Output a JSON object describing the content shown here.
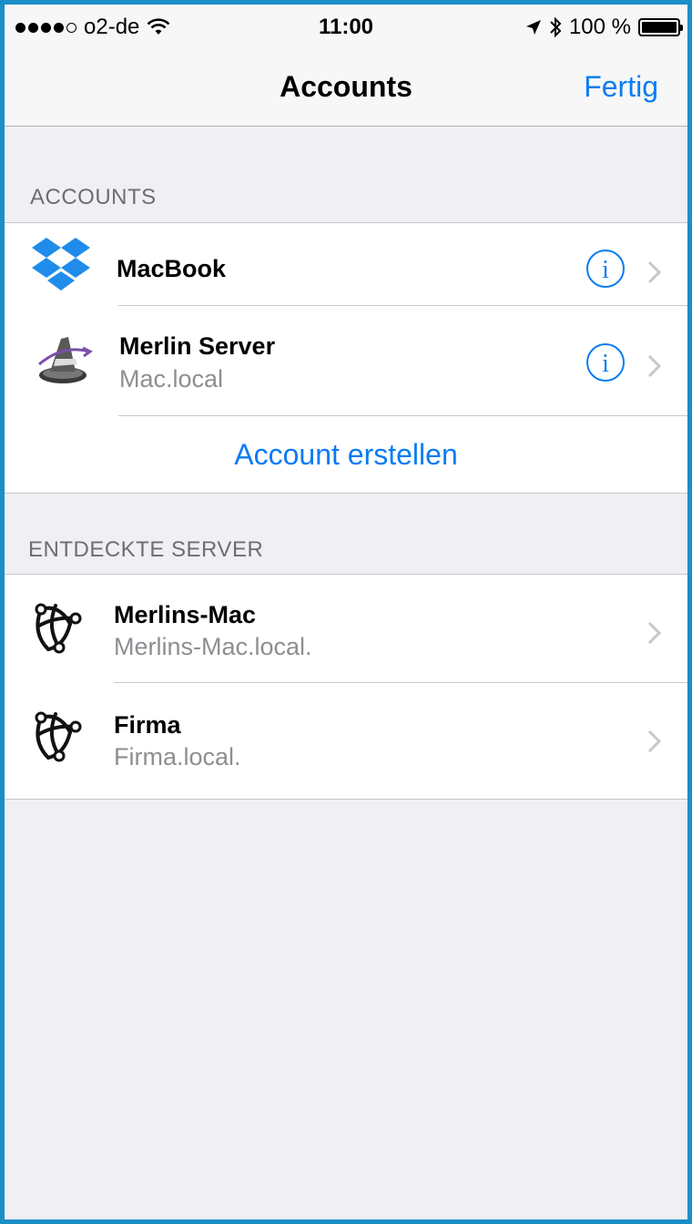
{
  "status_bar": {
    "carrier": "o2-de",
    "time": "11:00",
    "battery_percent": "100 %"
  },
  "nav": {
    "title": "Accounts",
    "done_label": "Fertig"
  },
  "accounts_section": {
    "header": "ACCOUNTS",
    "items": [
      {
        "title": "MacBook",
        "subtitle": "",
        "icon": "dropbox-icon"
      },
      {
        "title": "Merlin Server",
        "subtitle": "Mac.local",
        "icon": "wizard-hat-icon"
      }
    ],
    "create_label": "Account erstellen"
  },
  "discovered_section": {
    "header": "ENTDECKTE SERVER",
    "items": [
      {
        "title": "Merlins-Mac",
        "subtitle": "Merlins-Mac.local.",
        "icon": "bonjour-icon"
      },
      {
        "title": "Firma",
        "subtitle": "Firma.local.",
        "icon": "bonjour-icon"
      }
    ]
  },
  "colors": {
    "accent": "#0a7cf3",
    "background": "#efeff4",
    "frame": "#1b8ec8"
  }
}
